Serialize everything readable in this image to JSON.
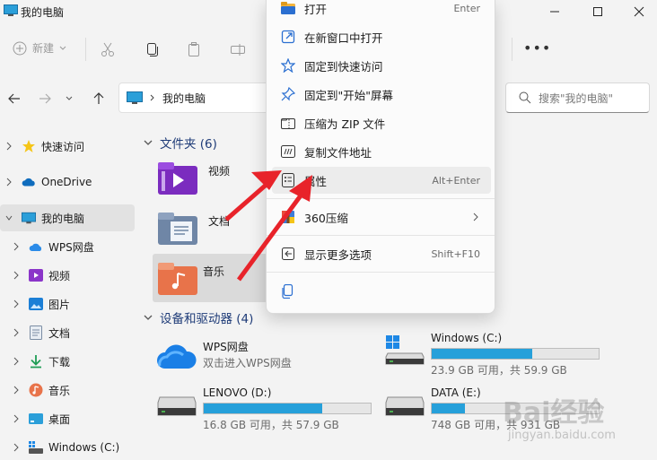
{
  "window": {
    "title": "我的电脑"
  },
  "toolbar": {
    "new_label": "新建"
  },
  "address": {
    "path": "我的电脑"
  },
  "search": {
    "placeholder": "搜索\"我的电脑\""
  },
  "sidebar": {
    "items": [
      {
        "label": "快速访问"
      },
      {
        "label": "OneDrive"
      },
      {
        "label": "我的电脑"
      },
      {
        "label": "WPS网盘"
      },
      {
        "label": "视频"
      },
      {
        "label": "图片"
      },
      {
        "label": "文档"
      },
      {
        "label": "下载"
      },
      {
        "label": "音乐"
      },
      {
        "label": "桌面"
      },
      {
        "label": "Windows (C:)"
      }
    ]
  },
  "folders_section": {
    "title": "文件夹 (6)"
  },
  "folders": [
    {
      "label": "视频"
    },
    {
      "label": "文档"
    },
    {
      "label": "音乐"
    }
  ],
  "drives_section": {
    "title": "设备和驱动器 (4)"
  },
  "drives": [
    {
      "name": "WPS网盘",
      "sub": "双击进入WPS网盘"
    },
    {
      "name": "Windows (C:)",
      "sub": "23.9 GB 可用，共 59.9 GB",
      "used_fraction": 0.6
    },
    {
      "name": "LENOVO (D:)",
      "sub": "16.8 GB 可用，共 57.9 GB",
      "used_fraction": 0.71
    },
    {
      "name": "DATA (E:)",
      "sub": "748 GB 可用，共 931 GB",
      "used_fraction": 0.2
    }
  ],
  "context_menu": {
    "open": "打开",
    "open_key": "Enter",
    "open_new_window": "在新窗口中打开",
    "pin_quick_access": "固定到快速访问",
    "pin_start": "固定到\"开始\"屏幕",
    "compress_zip": "压缩为 ZIP 文件",
    "copy_path": "复制文件地址",
    "properties": "属性",
    "properties_key": "Alt+Enter",
    "compress_360": "360压缩",
    "more_options": "显示更多选项",
    "more_options_key": "Shift+F10"
  },
  "watermark": {
    "text": "Bai经验",
    "sub": "jingyan.baidu.com"
  },
  "colors": {
    "accent": "#26a0da",
    "arrow": "#e8232a",
    "section": "#1f3c78"
  }
}
